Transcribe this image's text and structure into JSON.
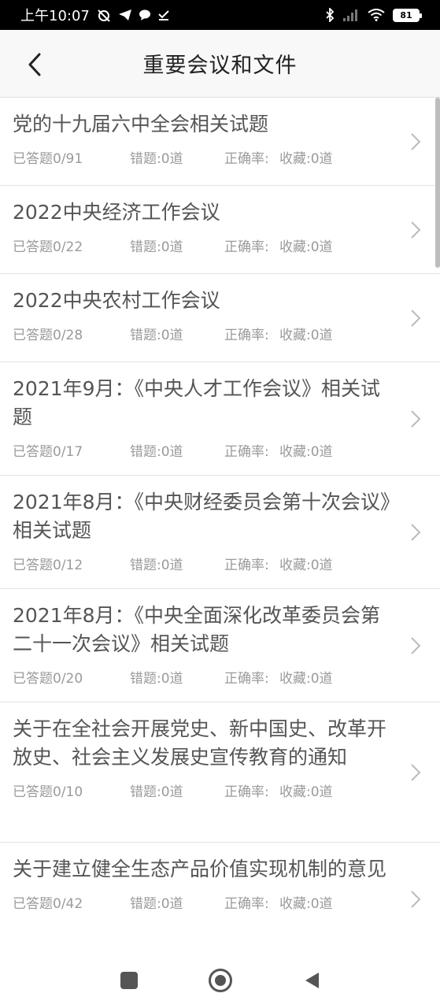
{
  "status": {
    "time": "上午10:07",
    "battery": "81",
    "left_icons": [
      "muted-alarm-icon",
      "telegram-icon",
      "chat-icon",
      "download-check-icon"
    ],
    "right_icons": [
      "bluetooth-icon",
      "signal-icon",
      "wifi-icon",
      "battery-icon"
    ]
  },
  "header": {
    "title": "重要会议和文件",
    "back_icon": "chevron-left-icon"
  },
  "items": [
    {
      "title": "党的十九届六中全会相关试题",
      "answered": "已答题0/91",
      "wrong": "错题:0道",
      "rate": "正确率:",
      "fav": "收藏:0道"
    },
    {
      "title": "2022中央经济工作会议",
      "answered": "已答题0/22",
      "wrong": "错题:0道",
      "rate": "正确率:",
      "fav": "收藏:0道"
    },
    {
      "title": "2022中央农村工作会议",
      "answered": "已答题0/28",
      "wrong": "错题:0道",
      "rate": "正确率:",
      "fav": "收藏:0道"
    },
    {
      "title": "2021年9月：《中央人才工作会议》相关试题",
      "answered": "已答题0/17",
      "wrong": "错题:0道",
      "rate": "正确率:",
      "fav": "收藏:0道"
    },
    {
      "title": "2021年8月：《中央财经委员会第十次会议》相关试题",
      "answered": "已答题0/12",
      "wrong": "错题:0道",
      "rate": "正确率:",
      "fav": "收藏:0道"
    },
    {
      "title": "2021年8月：《中央全面深化改革委员会第二十一次会议》相关试题",
      "answered": "已答题0/20",
      "wrong": "错题:0道",
      "rate": "正确率:",
      "fav": "收藏:0道"
    },
    {
      "title": "关于在全社会开展党史、新中国史、改革开放史、社会主义发展史宣传教育的通知",
      "answered": "已答题0/10",
      "wrong": "错题:0道",
      "rate": "正确率:",
      "fav": "收藏:0道"
    },
    {
      "title": "关于建立健全生态产品价值实现机制的意见",
      "answered": "已答题0/42",
      "wrong": "错题:0道",
      "rate": "正确率:",
      "fav": "收藏:0道"
    }
  ],
  "colors": {
    "status_bg": "#000000",
    "header_bg": "#f8f8f8",
    "title_text": "#555555",
    "meta_text": "#9a9a9a",
    "divider": "#e3e3e3"
  },
  "nav": {
    "icons": [
      "recents-square-icon",
      "home-circle-icon",
      "back-triangle-icon"
    ]
  }
}
